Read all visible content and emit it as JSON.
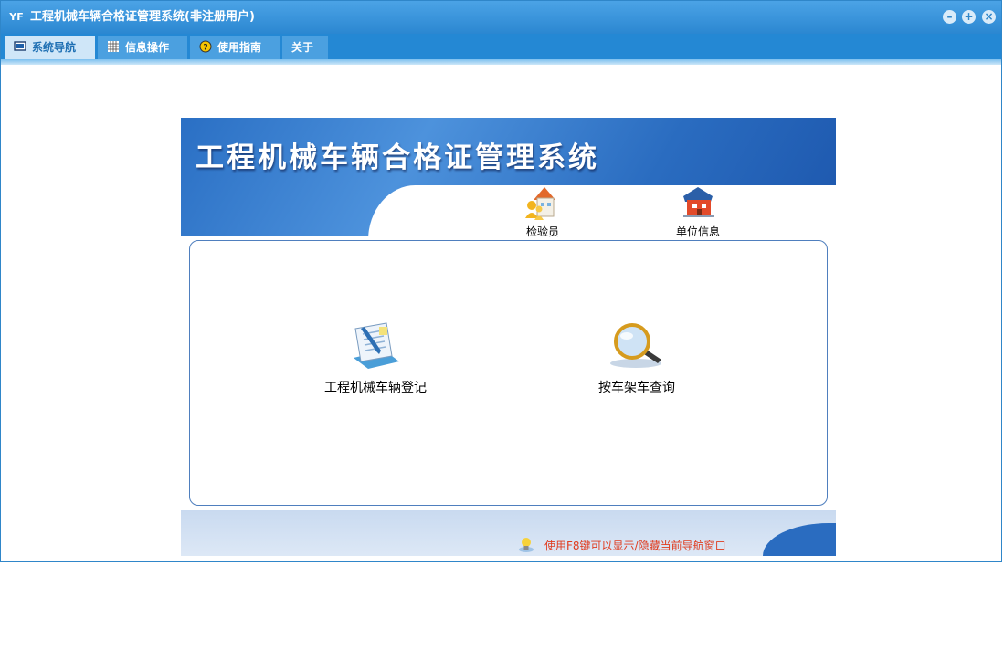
{
  "window": {
    "title": "工程机械车辆合格证管理系统(非注册用户)",
    "app_icon": "YF",
    "controls": [
      "minimize-icon",
      "restore-icon",
      "close-icon"
    ]
  },
  "tabs": [
    {
      "label": "系统导航",
      "icon": "monitor-icon",
      "active": true
    },
    {
      "label": "信息操作",
      "icon": "grid-icon",
      "active": false
    },
    {
      "label": "使用指南",
      "icon": "help-icon",
      "active": false
    },
    {
      "label": "关于",
      "active": false
    }
  ],
  "banner": {
    "title": "工程机械车辆合格证管理系统"
  },
  "top_items": [
    {
      "label": "检验员",
      "icon": "inspector-icon"
    },
    {
      "label": "单位信息",
      "icon": "company-icon"
    }
  ],
  "main_items": [
    {
      "label": "工程机械车辆登记",
      "icon": "register-document-icon"
    },
    {
      "label": "按车架车查询",
      "icon": "magnifier-icon"
    }
  ],
  "footer": {
    "hint": "使用F8键可以显示/隐藏当前导航窗口",
    "hint_icon": "lightbulb-icon"
  },
  "colors": {
    "titlebar": "#2f86c9",
    "tab_active_bg": "#cfe6f8",
    "hint_text": "#e03c1f",
    "banner": "#2a6fc4"
  }
}
